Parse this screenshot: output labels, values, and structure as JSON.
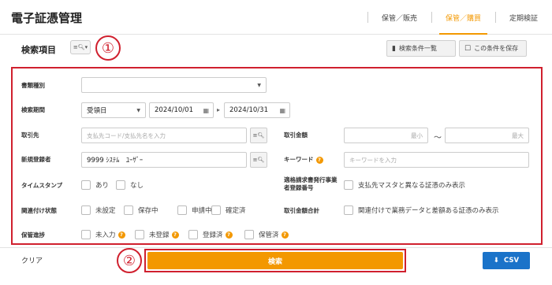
{
  "header": {
    "title": "電子証憑管理",
    "nav": [
      {
        "label": "保管／販売",
        "active": false
      },
      {
        "label": "保管／購買",
        "active": true
      },
      {
        "label": "定期検証",
        "active": false
      }
    ],
    "accent_color": "#f39800"
  },
  "subheader": {
    "title": "検索項目",
    "toggle_icon": "search-list-icon",
    "saved_conditions_label": "検索条件一覧",
    "save_condition_label": "この条件を保存"
  },
  "annotations": {
    "marker_1": "①",
    "marker_2": "②",
    "color": "#d0202e"
  },
  "form": {
    "doc_type": {
      "label": "書類種別",
      "value": ""
    },
    "period": {
      "label": "検索期間",
      "basis": "受領日",
      "from": "2024/10/01",
      "to": "2024/10/31"
    },
    "supplier": {
      "label": "取引先",
      "placeholder": "支払先コード/支払先名を入力"
    },
    "amount": {
      "label": "取引金額",
      "min_placeholder": "最小",
      "max_placeholder": "最大",
      "separator": "～"
    },
    "registrant": {
      "label": "新規登録者",
      "value": "9999 ｼｽﾃﾑ　ﾕｰｻﾞｰ"
    },
    "keyword": {
      "label": "キーワード",
      "placeholder": "キーワードを入力"
    },
    "timestamp": {
      "label": "タイムスタンプ",
      "options": [
        "あり",
        "なし"
      ]
    },
    "invoice_reg": {
      "label_line1": "適格請求書発行事業",
      "label_line2": "者登録番号",
      "option": "支払先マスタと異なる証憑のみ表示"
    },
    "link_status": {
      "label": "関連付け状態",
      "options": [
        "未設定",
        "保存中",
        "申請中",
        "確定済"
      ]
    },
    "amount_total": {
      "label": "取引金額合計",
      "option": "関連付けで業務データと差額ある証憑のみ表示"
    },
    "progress": {
      "label": "保管進捗",
      "options": [
        "未入力",
        "未登録",
        "登録済",
        "保管済"
      ]
    }
  },
  "footer": {
    "clear_label": "クリア",
    "search_label": "検索",
    "csv_label": "CSV",
    "search_color": "#f39800",
    "csv_color": "#1a73c9"
  }
}
